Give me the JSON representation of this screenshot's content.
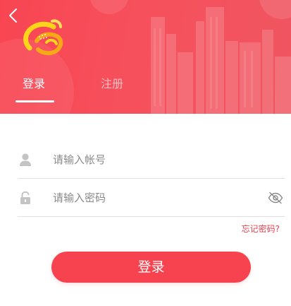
{
  "colors": {
    "accent": "#f7434f",
    "header_start": "#f94552",
    "header_end": "#ef5560",
    "link": "#e8424e",
    "placeholder": "#8a8a8a",
    "divider": "#e1e1e1"
  },
  "header": {
    "back_icon": "chevron-left-icon",
    "logo_icon": "swirl-logo",
    "tabs": [
      {
        "label": "登录",
        "active": true
      },
      {
        "label": "注册",
        "active": false
      }
    ]
  },
  "form": {
    "account": {
      "icon": "user-icon",
      "value": "",
      "placeholder": "请输入帐号"
    },
    "password": {
      "icon": "lock-icon",
      "value": "",
      "placeholder": "请输入密码",
      "toggle_icon": "eye-hidden-icon"
    },
    "forgot_label": "忘记密码?",
    "submit_label": "登录"
  }
}
